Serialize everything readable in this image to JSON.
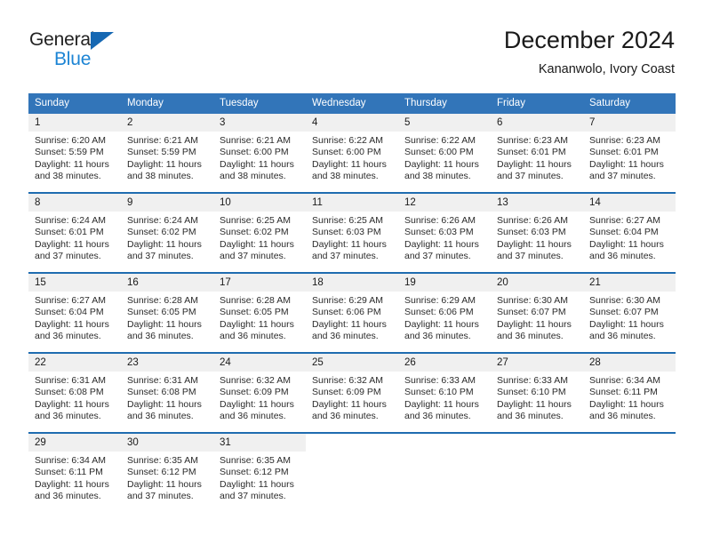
{
  "brand": {
    "word_one": "General",
    "word_two": "Blue",
    "triangle_color": "#1668b3",
    "blue_text_color": "#1c84d4"
  },
  "header": {
    "title": "December 2024",
    "location": "Kananwolo, Ivory Coast"
  },
  "theme": {
    "header_band": "#3275b9",
    "week_divider": "#1f6cb0",
    "daynum_band": "#f0f0f0",
    "page_background": "#ffffff"
  },
  "weekdays": [
    "Sunday",
    "Monday",
    "Tuesday",
    "Wednesday",
    "Thursday",
    "Friday",
    "Saturday"
  ],
  "labels": {
    "sunrise_prefix": "Sunrise:",
    "sunset_prefix": "Sunset:",
    "daylight_prefix": "Daylight:"
  },
  "weeks": [
    [
      {
        "day": "1",
        "sunrise": "Sunrise: 6:20 AM",
        "sunset": "Sunset: 5:59 PM",
        "daylight_line1": "Daylight: 11 hours",
        "daylight_line2": "and 38 minutes."
      },
      {
        "day": "2",
        "sunrise": "Sunrise: 6:21 AM",
        "sunset": "Sunset: 5:59 PM",
        "daylight_line1": "Daylight: 11 hours",
        "daylight_line2": "and 38 minutes."
      },
      {
        "day": "3",
        "sunrise": "Sunrise: 6:21 AM",
        "sunset": "Sunset: 6:00 PM",
        "daylight_line1": "Daylight: 11 hours",
        "daylight_line2": "and 38 minutes."
      },
      {
        "day": "4",
        "sunrise": "Sunrise: 6:22 AM",
        "sunset": "Sunset: 6:00 PM",
        "daylight_line1": "Daylight: 11 hours",
        "daylight_line2": "and 38 minutes."
      },
      {
        "day": "5",
        "sunrise": "Sunrise: 6:22 AM",
        "sunset": "Sunset: 6:00 PM",
        "daylight_line1": "Daylight: 11 hours",
        "daylight_line2": "and 38 minutes."
      },
      {
        "day": "6",
        "sunrise": "Sunrise: 6:23 AM",
        "sunset": "Sunset: 6:01 PM",
        "daylight_line1": "Daylight: 11 hours",
        "daylight_line2": "and 37 minutes."
      },
      {
        "day": "7",
        "sunrise": "Sunrise: 6:23 AM",
        "sunset": "Sunset: 6:01 PM",
        "daylight_line1": "Daylight: 11 hours",
        "daylight_line2": "and 37 minutes."
      }
    ],
    [
      {
        "day": "8",
        "sunrise": "Sunrise: 6:24 AM",
        "sunset": "Sunset: 6:01 PM",
        "daylight_line1": "Daylight: 11 hours",
        "daylight_line2": "and 37 minutes."
      },
      {
        "day": "9",
        "sunrise": "Sunrise: 6:24 AM",
        "sunset": "Sunset: 6:02 PM",
        "daylight_line1": "Daylight: 11 hours",
        "daylight_line2": "and 37 minutes."
      },
      {
        "day": "10",
        "sunrise": "Sunrise: 6:25 AM",
        "sunset": "Sunset: 6:02 PM",
        "daylight_line1": "Daylight: 11 hours",
        "daylight_line2": "and 37 minutes."
      },
      {
        "day": "11",
        "sunrise": "Sunrise: 6:25 AM",
        "sunset": "Sunset: 6:03 PM",
        "daylight_line1": "Daylight: 11 hours",
        "daylight_line2": "and 37 minutes."
      },
      {
        "day": "12",
        "sunrise": "Sunrise: 6:26 AM",
        "sunset": "Sunset: 6:03 PM",
        "daylight_line1": "Daylight: 11 hours",
        "daylight_line2": "and 37 minutes."
      },
      {
        "day": "13",
        "sunrise": "Sunrise: 6:26 AM",
        "sunset": "Sunset: 6:03 PM",
        "daylight_line1": "Daylight: 11 hours",
        "daylight_line2": "and 37 minutes."
      },
      {
        "day": "14",
        "sunrise": "Sunrise: 6:27 AM",
        "sunset": "Sunset: 6:04 PM",
        "daylight_line1": "Daylight: 11 hours",
        "daylight_line2": "and 36 minutes."
      }
    ],
    [
      {
        "day": "15",
        "sunrise": "Sunrise: 6:27 AM",
        "sunset": "Sunset: 6:04 PM",
        "daylight_line1": "Daylight: 11 hours",
        "daylight_line2": "and 36 minutes."
      },
      {
        "day": "16",
        "sunrise": "Sunrise: 6:28 AM",
        "sunset": "Sunset: 6:05 PM",
        "daylight_line1": "Daylight: 11 hours",
        "daylight_line2": "and 36 minutes."
      },
      {
        "day": "17",
        "sunrise": "Sunrise: 6:28 AM",
        "sunset": "Sunset: 6:05 PM",
        "daylight_line1": "Daylight: 11 hours",
        "daylight_line2": "and 36 minutes."
      },
      {
        "day": "18",
        "sunrise": "Sunrise: 6:29 AM",
        "sunset": "Sunset: 6:06 PM",
        "daylight_line1": "Daylight: 11 hours",
        "daylight_line2": "and 36 minutes."
      },
      {
        "day": "19",
        "sunrise": "Sunrise: 6:29 AM",
        "sunset": "Sunset: 6:06 PM",
        "daylight_line1": "Daylight: 11 hours",
        "daylight_line2": "and 36 minutes."
      },
      {
        "day": "20",
        "sunrise": "Sunrise: 6:30 AM",
        "sunset": "Sunset: 6:07 PM",
        "daylight_line1": "Daylight: 11 hours",
        "daylight_line2": "and 36 minutes."
      },
      {
        "day": "21",
        "sunrise": "Sunrise: 6:30 AM",
        "sunset": "Sunset: 6:07 PM",
        "daylight_line1": "Daylight: 11 hours",
        "daylight_line2": "and 36 minutes."
      }
    ],
    [
      {
        "day": "22",
        "sunrise": "Sunrise: 6:31 AM",
        "sunset": "Sunset: 6:08 PM",
        "daylight_line1": "Daylight: 11 hours",
        "daylight_line2": "and 36 minutes."
      },
      {
        "day": "23",
        "sunrise": "Sunrise: 6:31 AM",
        "sunset": "Sunset: 6:08 PM",
        "daylight_line1": "Daylight: 11 hours",
        "daylight_line2": "and 36 minutes."
      },
      {
        "day": "24",
        "sunrise": "Sunrise: 6:32 AM",
        "sunset": "Sunset: 6:09 PM",
        "daylight_line1": "Daylight: 11 hours",
        "daylight_line2": "and 36 minutes."
      },
      {
        "day": "25",
        "sunrise": "Sunrise: 6:32 AM",
        "sunset": "Sunset: 6:09 PM",
        "daylight_line1": "Daylight: 11 hours",
        "daylight_line2": "and 36 minutes."
      },
      {
        "day": "26",
        "sunrise": "Sunrise: 6:33 AM",
        "sunset": "Sunset: 6:10 PM",
        "daylight_line1": "Daylight: 11 hours",
        "daylight_line2": "and 36 minutes."
      },
      {
        "day": "27",
        "sunrise": "Sunrise: 6:33 AM",
        "sunset": "Sunset: 6:10 PM",
        "daylight_line1": "Daylight: 11 hours",
        "daylight_line2": "and 36 minutes."
      },
      {
        "day": "28",
        "sunrise": "Sunrise: 6:34 AM",
        "sunset": "Sunset: 6:11 PM",
        "daylight_line1": "Daylight: 11 hours",
        "daylight_line2": "and 36 minutes."
      }
    ],
    [
      {
        "day": "29",
        "sunrise": "Sunrise: 6:34 AM",
        "sunset": "Sunset: 6:11 PM",
        "daylight_line1": "Daylight: 11 hours",
        "daylight_line2": "and 36 minutes."
      },
      {
        "day": "30",
        "sunrise": "Sunrise: 6:35 AM",
        "sunset": "Sunset: 6:12 PM",
        "daylight_line1": "Daylight: 11 hours",
        "daylight_line2": "and 37 minutes."
      },
      {
        "day": "31",
        "sunrise": "Sunrise: 6:35 AM",
        "sunset": "Sunset: 6:12 PM",
        "daylight_line1": "Daylight: 11 hours",
        "daylight_line2": "and 37 minutes."
      },
      {
        "day": "",
        "sunrise": "",
        "sunset": "",
        "daylight_line1": "",
        "daylight_line2": ""
      },
      {
        "day": "",
        "sunrise": "",
        "sunset": "",
        "daylight_line1": "",
        "daylight_line2": ""
      },
      {
        "day": "",
        "sunrise": "",
        "sunset": "",
        "daylight_line1": "",
        "daylight_line2": ""
      },
      {
        "day": "",
        "sunrise": "",
        "sunset": "",
        "daylight_line1": "",
        "daylight_line2": ""
      }
    ]
  ]
}
